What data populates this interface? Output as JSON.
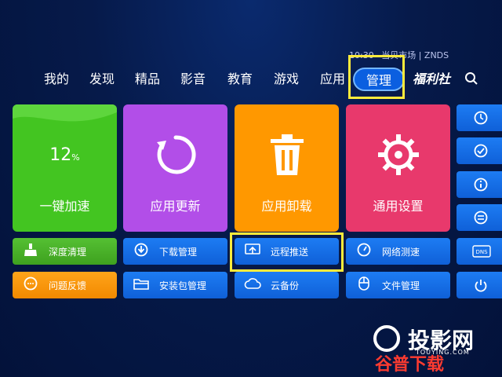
{
  "status_bar": {
    "time": "10:30",
    "brand": "当贝市场 | ZNDS"
  },
  "nav": {
    "items": [
      {
        "label": "我的"
      },
      {
        "label": "发现"
      },
      {
        "label": "精品"
      },
      {
        "label": "影音"
      },
      {
        "label": "教育"
      },
      {
        "label": "游戏"
      },
      {
        "label": "应用"
      },
      {
        "label": "管理",
        "active": true
      },
      {
        "label": "福利社"
      }
    ],
    "search_icon": "search-icon"
  },
  "tiles": [
    {
      "label": "一键加速",
      "value": "12",
      "unit": "%",
      "color": "#43c521"
    },
    {
      "label": "应用更新",
      "icon": "refresh-icon",
      "color": "#b24ee8"
    },
    {
      "label": "应用卸载",
      "icon": "trash-icon",
      "color": "#ff9800"
    },
    {
      "label": "通用设置",
      "icon": "gear-icon",
      "color": "#e8396c"
    }
  ],
  "buttons_row1": [
    {
      "label": "深度清理",
      "icon": "broom-icon"
    },
    {
      "label": "下载管理",
      "icon": "download-icon"
    },
    {
      "label": "远程推送",
      "icon": "cast-icon"
    },
    {
      "label": "网络测速",
      "icon": "speedometer-icon"
    }
  ],
  "buttons_row2": [
    {
      "label": "问题反馈",
      "icon": "chat-icon"
    },
    {
      "label": "安装包管理",
      "icon": "folder-icon"
    },
    {
      "label": "云备份",
      "icon": "cloud-icon"
    },
    {
      "label": "文件管理",
      "icon": "mouse-icon"
    }
  ],
  "right_column_icons": [
    "clock-icon",
    "check-icon",
    "info-icon",
    "list-icon",
    "dns-icon",
    "power-icon"
  ],
  "right_column_dns_label": "DNS",
  "watermark": {
    "main": "投影网",
    "sub": "谷普下载",
    "url": "TOUYING.COM"
  }
}
